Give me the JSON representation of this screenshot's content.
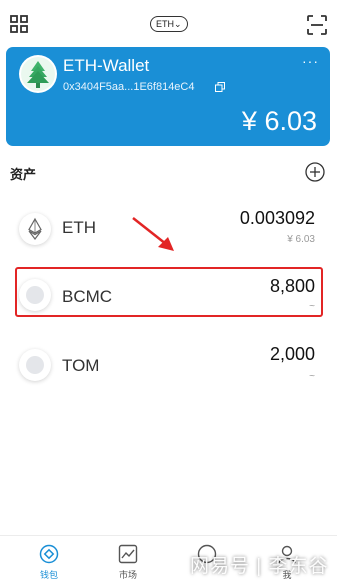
{
  "header": {
    "network": "ETH",
    "icons": {
      "menu": "grid-menu-icon",
      "scan": "scan-icon"
    }
  },
  "wallet": {
    "name": "ETH-Wallet",
    "address": "0x3404F5aa...1E6f814eC4",
    "balance": "¥ 6.03",
    "more": "···",
    "color": "#1a8fd6"
  },
  "assets": {
    "title": "资产",
    "items": [
      {
        "symbol": "ETH",
        "amount": "0.003092",
        "value": "¥ 6.03"
      },
      {
        "symbol": "BCMC",
        "amount": "8,800",
        "value": "~"
      },
      {
        "symbol": "TOM",
        "amount": "2,000",
        "value": "~"
      }
    ]
  },
  "annotation": {
    "highlight_color": "#e22525"
  },
  "nav": {
    "items": [
      {
        "label": "钱包",
        "icon": "wallet-icon"
      },
      {
        "label": "市场",
        "icon": "chart-icon"
      },
      {
        "label": "",
        "icon": "discover-icon"
      },
      {
        "label": "我",
        "icon": "profile-icon"
      }
    ]
  },
  "watermark": "网易号 | 李东谷"
}
